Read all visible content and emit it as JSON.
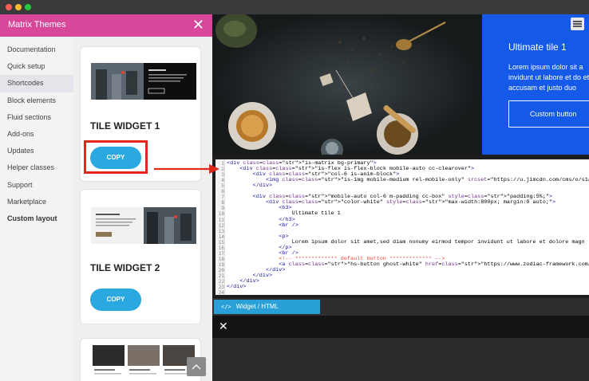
{
  "panel": {
    "title": "Matrix Themes",
    "close": "✕"
  },
  "nav": {
    "items": [
      {
        "label": "Documentation"
      },
      {
        "label": "Quick setup"
      },
      {
        "label": "Shortcodes"
      },
      {
        "label": "Block elements"
      },
      {
        "label": "Fluid sections"
      },
      {
        "label": "Add-ons"
      },
      {
        "label": "Updates"
      },
      {
        "label": "Helper classes"
      },
      {
        "label": "Support"
      },
      {
        "label": "Marketplace"
      },
      {
        "label": "Custom layout"
      }
    ],
    "active_index": 2
  },
  "widgets": [
    {
      "title": "TILE WIDGET 1",
      "button": "COPY"
    },
    {
      "title": "TILE WIDGET 2",
      "button": "COPY"
    }
  ],
  "scroll_top_icon": "chevron-up-icon",
  "tile": {
    "title": "Ultimate tile 1",
    "text": "Lorem ipsum dolor sit a invidunt ut labore et do et accusam et justo duo",
    "button": "Custom button",
    "color": "#1459e8"
  },
  "editor": {
    "line_numbers": [
      "1",
      "2",
      "3",
      "4",
      "5",
      "6",
      "7",
      "8",
      "9",
      "10",
      "11",
      "12",
      "13",
      "14",
      "15",
      "16",
      "17",
      "18",
      "19",
      "20",
      "21",
      "22",
      "23",
      "24"
    ],
    "lines": [
      "<div class=\"is-matrix bg-primary\">",
      "    <div class=\"is-flex is-flex-block mobile-auto cc-clearover\">",
      "        <div class=\"col-6 is-anim-block\">",
      "            <img class=\"is-img mobile-medium rel-mobile-only\" srcset=\"https://u.jimcdn.com/cms/o/s1aeecbbb2a5",
      "        </div>",
      "",
      "        <div class=\"mobile-auto col-6 m-padding cc-box\" style=\"padding:5%;\">",
      "            <div class=\"color-white\" style=\"max-width:800px; margin:0 auto;\">",
      "                <h3>",
      "                    Ultimate tile 1",
      "                </h3>",
      "                <br />",
      "",
      "                <p>",
      "                    Lorem ipsum dolor sit amet,sed diam nonumy eirmod tempor invidunt ut labore et dolore magn",
      "                </p>",
      "                <br />",
      "                <!-- ************* default button ************* -->",
      "                <a class=\"hs-button ghost-white\" href=\"https://www.zodiac-framework.com/\" target=\"\">Custom bu",
      "            </div>",
      "        </div>",
      "    </div>",
      "</div>",
      ""
    ]
  },
  "tab": {
    "icon": "code-icon",
    "label": "Widget / HTML"
  },
  "bottom": {
    "close": "✕"
  },
  "accent": {
    "pink": "#d9479a",
    "copy_blue": "#2aa9e0",
    "highlight_red": "#e3281b",
    "tab_blue": "#2aa0d8"
  }
}
